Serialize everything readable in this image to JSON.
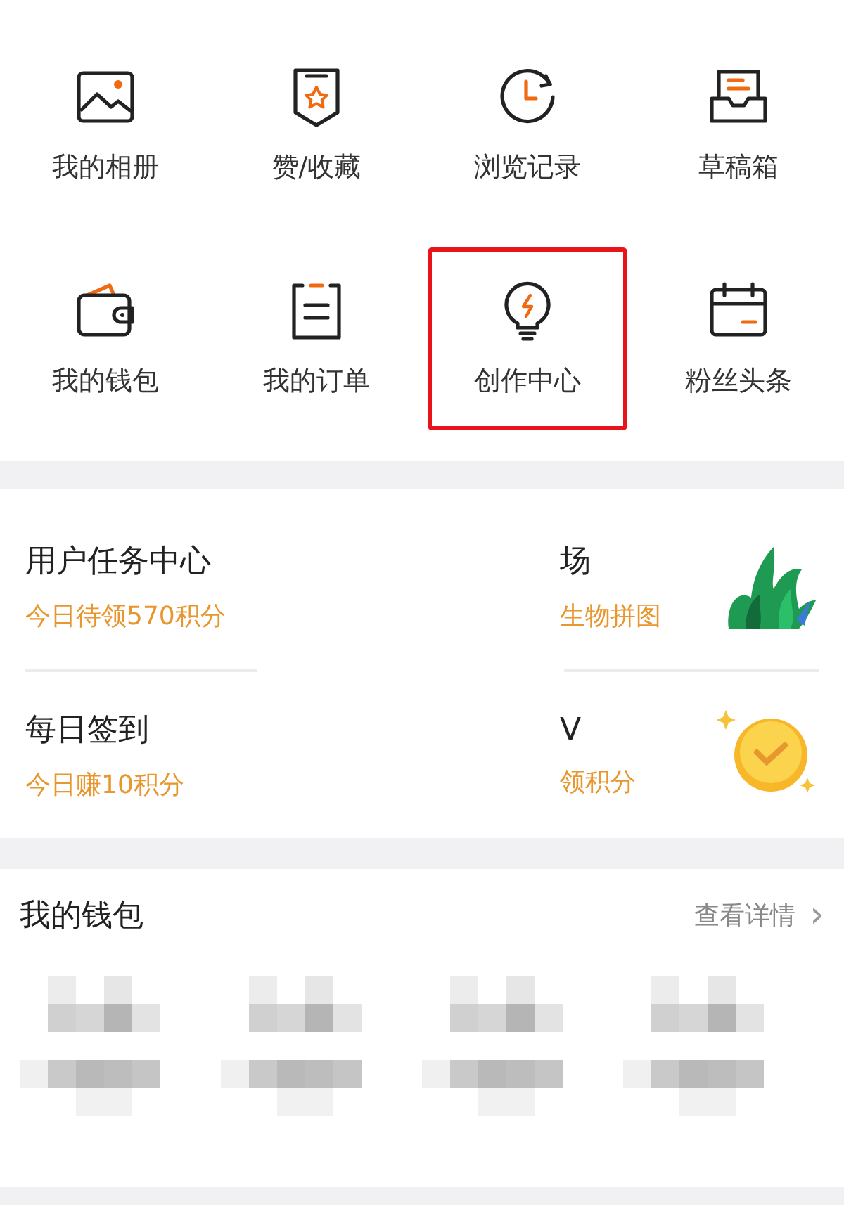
{
  "shortcuts": [
    {
      "label": "我的相册",
      "highlighted": false
    },
    {
      "label": "赞/收藏",
      "highlighted": false
    },
    {
      "label": "浏览记录",
      "highlighted": false
    },
    {
      "label": "草稿箱",
      "highlighted": false
    },
    {
      "label": "我的钱包",
      "highlighted": false
    },
    {
      "label": "我的订单",
      "highlighted": false
    },
    {
      "label": "创作中心",
      "highlighted": true
    },
    {
      "label": "粉丝头条",
      "highlighted": false
    }
  ],
  "tasks": [
    {
      "title": "用户任务中心",
      "subtitle": "今日待领570积分",
      "right_title": "场",
      "right_subtitle": "生物拼图"
    },
    {
      "title": "每日签到",
      "subtitle": "今日赚10积分",
      "right_title": "V",
      "right_subtitle": "领积分"
    }
  ],
  "wallet": {
    "title": "我的钱包",
    "link": "查看详情",
    "chevron": "›"
  }
}
